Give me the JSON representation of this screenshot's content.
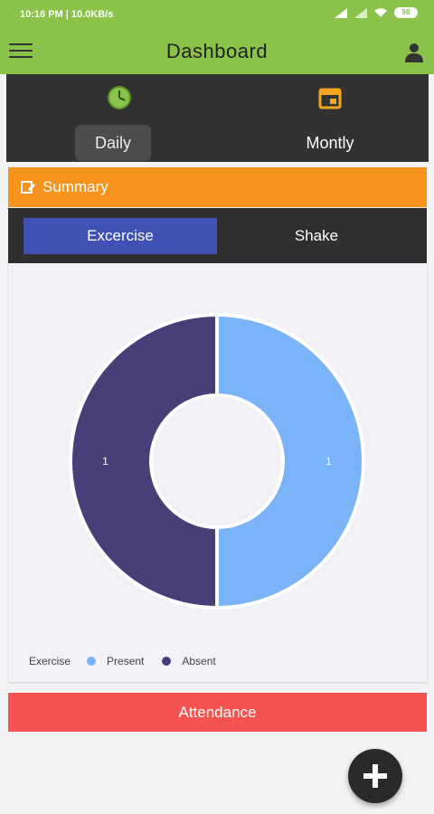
{
  "status_bar": {
    "time_text": "10:16 PM | 10.0KB/s",
    "battery": "98"
  },
  "app_bar": {
    "title": "Dashboard"
  },
  "period_tabs": [
    {
      "label": "Daily",
      "icon": "clock-icon",
      "selected": true
    },
    {
      "label": "Montly",
      "icon": "calendar-icon",
      "selected": false
    }
  ],
  "summary": {
    "label": "Summary",
    "icon": "edit-icon"
  },
  "type_tabs": [
    {
      "label": "Excercise",
      "selected": true
    },
    {
      "label": "Shake",
      "selected": false
    }
  ],
  "chart_data": {
    "type": "pie",
    "categories": [
      "Present",
      "Absent"
    ],
    "values": [
      1,
      1
    ],
    "colors": [
      "#7ab3f8",
      "#483f78"
    ],
    "legend_title": "Exercise",
    "legend_position": "bottom-left"
  },
  "attendance_label": "Attendance",
  "colors": {
    "app_bar": "#8bc34a",
    "summary": "#f7931e",
    "selected_tab": "#3f51b5",
    "attendance": "#f55350",
    "dark_panel": "#323232"
  }
}
